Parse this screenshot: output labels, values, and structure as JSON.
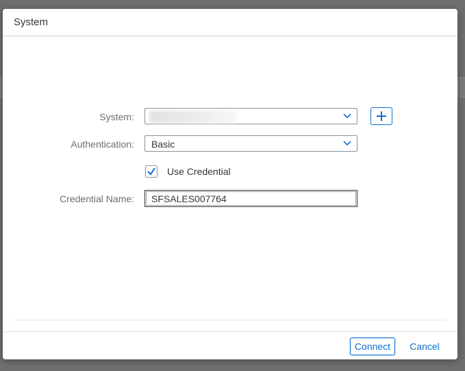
{
  "dialog": {
    "title": "System"
  },
  "form": {
    "system": {
      "label": "System:",
      "icon": "chevron-down-icon"
    },
    "authentication": {
      "label": "Authentication:",
      "value": "Basic",
      "icon": "chevron-down-icon"
    },
    "use_credential": {
      "label": "Use Credential",
      "checked": true
    },
    "credential_name": {
      "label": "Credential Name:",
      "value": "SFSALES007764"
    },
    "add_system_icon": "plus-icon"
  },
  "footer": {
    "connect_label": "Connect",
    "cancel_label": "Cancel"
  },
  "colors": {
    "accent": "#0a6ed1",
    "text": "#32363a",
    "label": "#6a6d70"
  }
}
